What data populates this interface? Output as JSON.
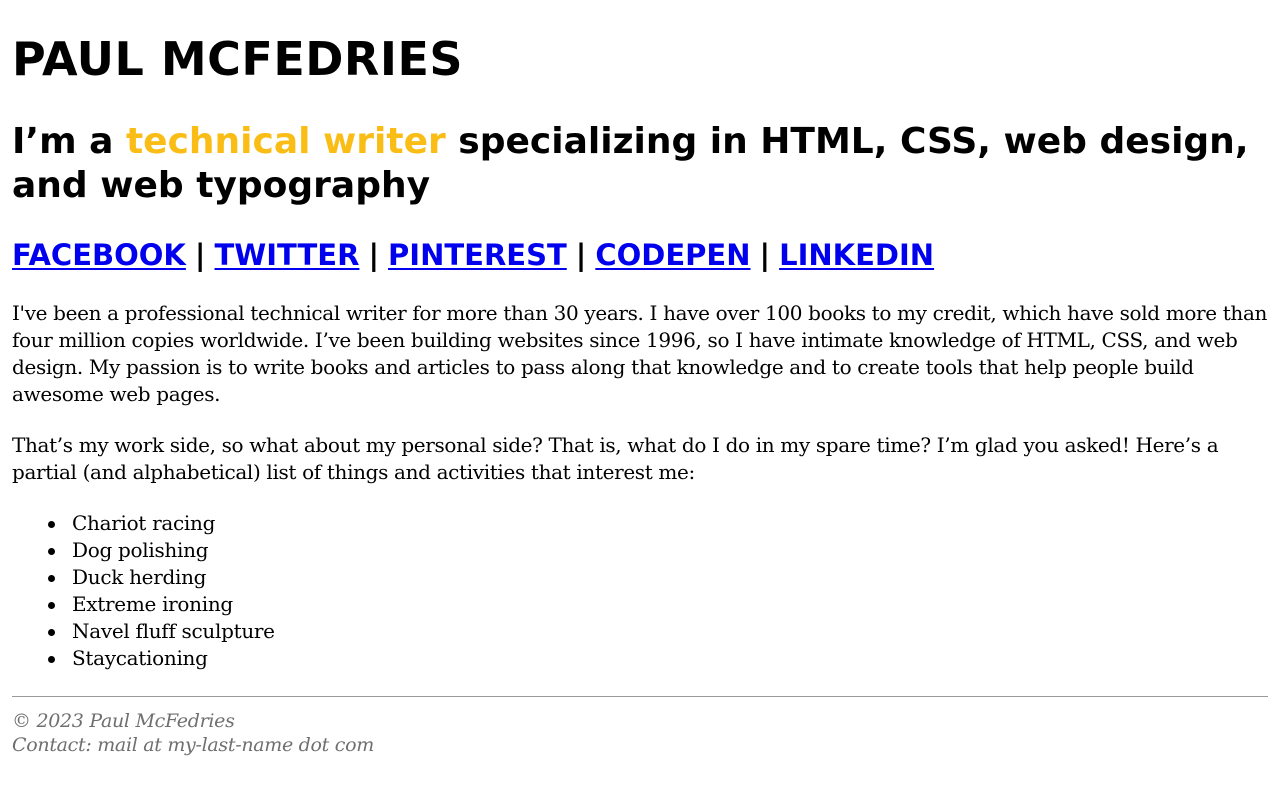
{
  "header": {
    "site_title": "PAUL MCFEDRIES",
    "tagline": {
      "prefix": "I’m a ",
      "highlight": "technical writer",
      "suffix": " specializing in HTML, CSS, web design, and web typography"
    },
    "accent_color": "#f9bd15"
  },
  "social": {
    "separator": "|",
    "links": [
      {
        "label": "FACEBOOK"
      },
      {
        "label": "TWITTER"
      },
      {
        "label": "PINTEREST"
      },
      {
        "label": "CODEPEN"
      },
      {
        "label": "LINKEDIN"
      }
    ],
    "link_color": "#0000ee"
  },
  "main": {
    "paragraphs": [
      "I've been a professional technical writer for more than 30 years. I have over 100 books to my credit, which have sold more than four million copies worldwide. I’ve been building websites since 1996, so I have intimate knowledge of HTML, CSS, and web design. My passion is to write books and articles to pass along that knowledge and to create tools that help people build awesome web pages.",
      "That’s my work side, so what about my personal side? That is, what do I do in my spare time? I’m glad you asked! Here’s a partial (and alphabetical) list of things and activities that interest me:"
    ],
    "interests": [
      "Chariot racing",
      "Dog polishing",
      "Duck herding",
      "Extreme ironing",
      "Navel fluff sculpture",
      "Staycationing"
    ]
  },
  "footer": {
    "copyright": "© 2023 Paul McFedries",
    "contact": "Contact: mail at my-last-name dot com",
    "text_color": "#6f6f6f"
  }
}
